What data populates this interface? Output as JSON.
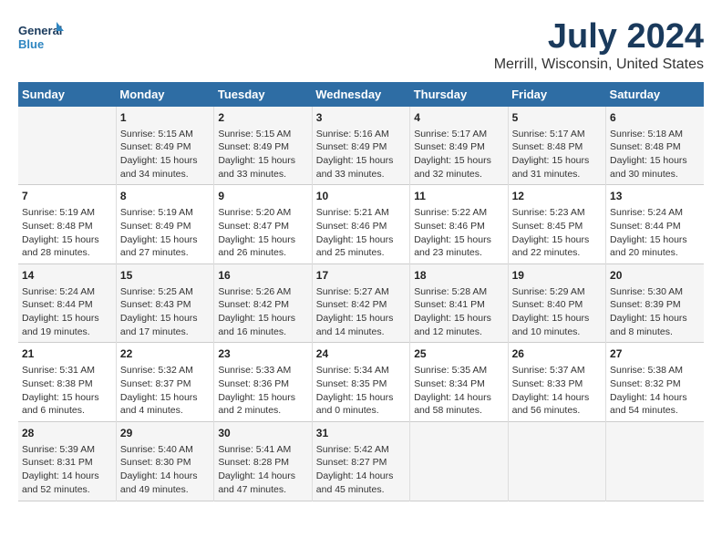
{
  "logo": {
    "line1": "General",
    "line2": "Blue"
  },
  "title": "July 2024",
  "subtitle": "Merrill, Wisconsin, United States",
  "days_header": [
    "Sunday",
    "Monday",
    "Tuesday",
    "Wednesday",
    "Thursday",
    "Friday",
    "Saturday"
  ],
  "weeks": [
    [
      {
        "day": "",
        "sunrise": "",
        "sunset": "",
        "daylight": ""
      },
      {
        "day": "1",
        "sunrise": "Sunrise: 5:15 AM",
        "sunset": "Sunset: 8:49 PM",
        "daylight": "Daylight: 15 hours and 34 minutes."
      },
      {
        "day": "2",
        "sunrise": "Sunrise: 5:15 AM",
        "sunset": "Sunset: 8:49 PM",
        "daylight": "Daylight: 15 hours and 33 minutes."
      },
      {
        "day": "3",
        "sunrise": "Sunrise: 5:16 AM",
        "sunset": "Sunset: 8:49 PM",
        "daylight": "Daylight: 15 hours and 33 minutes."
      },
      {
        "day": "4",
        "sunrise": "Sunrise: 5:17 AM",
        "sunset": "Sunset: 8:49 PM",
        "daylight": "Daylight: 15 hours and 32 minutes."
      },
      {
        "day": "5",
        "sunrise": "Sunrise: 5:17 AM",
        "sunset": "Sunset: 8:48 PM",
        "daylight": "Daylight: 15 hours and 31 minutes."
      },
      {
        "day": "6",
        "sunrise": "Sunrise: 5:18 AM",
        "sunset": "Sunset: 8:48 PM",
        "daylight": "Daylight: 15 hours and 30 minutes."
      }
    ],
    [
      {
        "day": "7",
        "sunrise": "Sunrise: 5:19 AM",
        "sunset": "Sunset: 8:48 PM",
        "daylight": "Daylight: 15 hours and 28 minutes."
      },
      {
        "day": "8",
        "sunrise": "Sunrise: 5:19 AM",
        "sunset": "Sunset: 8:49 PM",
        "daylight": "Daylight: 15 hours and 27 minutes."
      },
      {
        "day": "9",
        "sunrise": "Sunrise: 5:20 AM",
        "sunset": "Sunset: 8:47 PM",
        "daylight": "Daylight: 15 hours and 26 minutes."
      },
      {
        "day": "10",
        "sunrise": "Sunrise: 5:21 AM",
        "sunset": "Sunset: 8:46 PM",
        "daylight": "Daylight: 15 hours and 25 minutes."
      },
      {
        "day": "11",
        "sunrise": "Sunrise: 5:22 AM",
        "sunset": "Sunset: 8:46 PM",
        "daylight": "Daylight: 15 hours and 23 minutes."
      },
      {
        "day": "12",
        "sunrise": "Sunrise: 5:23 AM",
        "sunset": "Sunset: 8:45 PM",
        "daylight": "Daylight: 15 hours and 22 minutes."
      },
      {
        "day": "13",
        "sunrise": "Sunrise: 5:24 AM",
        "sunset": "Sunset: 8:44 PM",
        "daylight": "Daylight: 15 hours and 20 minutes."
      }
    ],
    [
      {
        "day": "14",
        "sunrise": "Sunrise: 5:24 AM",
        "sunset": "Sunset: 8:44 PM",
        "daylight": "Daylight: 15 hours and 19 minutes."
      },
      {
        "day": "15",
        "sunrise": "Sunrise: 5:25 AM",
        "sunset": "Sunset: 8:43 PM",
        "daylight": "Daylight: 15 hours and 17 minutes."
      },
      {
        "day": "16",
        "sunrise": "Sunrise: 5:26 AM",
        "sunset": "Sunset: 8:42 PM",
        "daylight": "Daylight: 15 hours and 16 minutes."
      },
      {
        "day": "17",
        "sunrise": "Sunrise: 5:27 AM",
        "sunset": "Sunset: 8:42 PM",
        "daylight": "Daylight: 15 hours and 14 minutes."
      },
      {
        "day": "18",
        "sunrise": "Sunrise: 5:28 AM",
        "sunset": "Sunset: 8:41 PM",
        "daylight": "Daylight: 15 hours and 12 minutes."
      },
      {
        "day": "19",
        "sunrise": "Sunrise: 5:29 AM",
        "sunset": "Sunset: 8:40 PM",
        "daylight": "Daylight: 15 hours and 10 minutes."
      },
      {
        "day": "20",
        "sunrise": "Sunrise: 5:30 AM",
        "sunset": "Sunset: 8:39 PM",
        "daylight": "Daylight: 15 hours and 8 minutes."
      }
    ],
    [
      {
        "day": "21",
        "sunrise": "Sunrise: 5:31 AM",
        "sunset": "Sunset: 8:38 PM",
        "daylight": "Daylight: 15 hours and 6 minutes."
      },
      {
        "day": "22",
        "sunrise": "Sunrise: 5:32 AM",
        "sunset": "Sunset: 8:37 PM",
        "daylight": "Daylight: 15 hours and 4 minutes."
      },
      {
        "day": "23",
        "sunrise": "Sunrise: 5:33 AM",
        "sunset": "Sunset: 8:36 PM",
        "daylight": "Daylight: 15 hours and 2 minutes."
      },
      {
        "day": "24",
        "sunrise": "Sunrise: 5:34 AM",
        "sunset": "Sunset: 8:35 PM",
        "daylight": "Daylight: 15 hours and 0 minutes."
      },
      {
        "day": "25",
        "sunrise": "Sunrise: 5:35 AM",
        "sunset": "Sunset: 8:34 PM",
        "daylight": "Daylight: 14 hours and 58 minutes."
      },
      {
        "day": "26",
        "sunrise": "Sunrise: 5:37 AM",
        "sunset": "Sunset: 8:33 PM",
        "daylight": "Daylight: 14 hours and 56 minutes."
      },
      {
        "day": "27",
        "sunrise": "Sunrise: 5:38 AM",
        "sunset": "Sunset: 8:32 PM",
        "daylight": "Daylight: 14 hours and 54 minutes."
      }
    ],
    [
      {
        "day": "28",
        "sunrise": "Sunrise: 5:39 AM",
        "sunset": "Sunset: 8:31 PM",
        "daylight": "Daylight: 14 hours and 52 minutes."
      },
      {
        "day": "29",
        "sunrise": "Sunrise: 5:40 AM",
        "sunset": "Sunset: 8:30 PM",
        "daylight": "Daylight: 14 hours and 49 minutes."
      },
      {
        "day": "30",
        "sunrise": "Sunrise: 5:41 AM",
        "sunset": "Sunset: 8:28 PM",
        "daylight": "Daylight: 14 hours and 47 minutes."
      },
      {
        "day": "31",
        "sunrise": "Sunrise: 5:42 AM",
        "sunset": "Sunset: 8:27 PM",
        "daylight": "Daylight: 14 hours and 45 minutes."
      },
      {
        "day": "",
        "sunrise": "",
        "sunset": "",
        "daylight": ""
      },
      {
        "day": "",
        "sunrise": "",
        "sunset": "",
        "daylight": ""
      },
      {
        "day": "",
        "sunrise": "",
        "sunset": "",
        "daylight": ""
      }
    ]
  ]
}
